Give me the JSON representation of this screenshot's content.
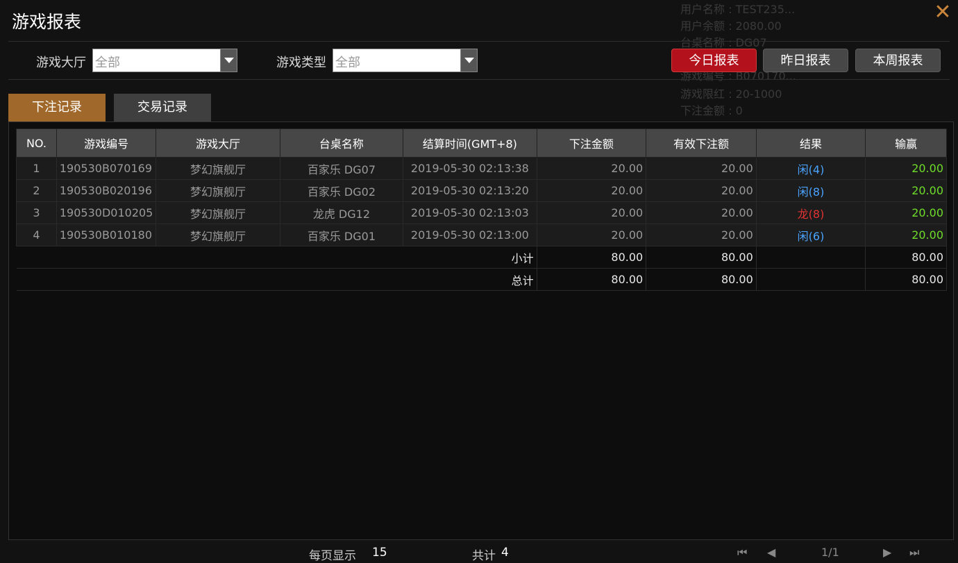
{
  "title": "游戏报表",
  "background_info": [
    "用户名称 : TEST235...",
    "用户余额 : 2080.00",
    "台桌名称 : DG07",
    "游戏编号 : B070170...",
    "游戏限红 : 20-1000",
    "下注金额 : 0"
  ],
  "filters": {
    "hall_label": "游戏大厅",
    "hall_value": "全部",
    "type_label": "游戏类型",
    "type_value": "全部"
  },
  "report_buttons": {
    "today": "今日报表",
    "yesterday": "昨日报表",
    "week": "本周报表"
  },
  "tabs": {
    "bet_records": "下注记录",
    "transaction_records": "交易记录"
  },
  "table": {
    "headers": [
      "NO.",
      "游戏编号",
      "游戏大厅",
      "台桌名称",
      "结算时间(GMT+8)",
      "下注金额",
      "有效下注额",
      "结果",
      "输赢"
    ],
    "rows": [
      {
        "no": "1",
        "game_id": "190530B070169",
        "hall": "梦幻旗舰厅",
        "table": "百家乐 DG07",
        "time": "2019-05-30 02:13:38",
        "bet": "20.00",
        "valid": "20.00",
        "result": "闲(4)",
        "result_color": "blue",
        "win": "20.00"
      },
      {
        "no": "2",
        "game_id": "190530B020196",
        "hall": "梦幻旗舰厅",
        "table": "百家乐 DG02",
        "time": "2019-05-30 02:13:20",
        "bet": "20.00",
        "valid": "20.00",
        "result": "闲(8)",
        "result_color": "blue",
        "win": "20.00"
      },
      {
        "no": "3",
        "game_id": "190530D010205",
        "hall": "梦幻旗舰厅",
        "table": "龙虎 DG12",
        "time": "2019-05-30 02:13:03",
        "bet": "20.00",
        "valid": "20.00",
        "result": "龙(8)",
        "result_color": "red",
        "win": "20.00"
      },
      {
        "no": "4",
        "game_id": "190530B010180",
        "hall": "梦幻旗舰厅",
        "table": "百家乐 DG01",
        "time": "2019-05-30 02:13:00",
        "bet": "20.00",
        "valid": "20.00",
        "result": "闲(6)",
        "result_color": "blue",
        "win": "20.00"
      }
    ],
    "subtotal": {
      "label": "小计",
      "bet": "80.00",
      "valid": "80.00",
      "win": "80.00"
    },
    "total": {
      "label": "总计",
      "bet": "80.00",
      "valid": "80.00",
      "win": "80.00"
    }
  },
  "footer": {
    "per_page_label": "每页显示",
    "per_page_value": "15",
    "total_label": "共计",
    "total_value": "4",
    "page": "1/1"
  },
  "colors": {
    "accent_red": "#b3121d",
    "tab_active": "#a0682a",
    "result_blue": "#4aa3ff",
    "result_red": "#e33232",
    "win_green": "#6fdc2a"
  }
}
